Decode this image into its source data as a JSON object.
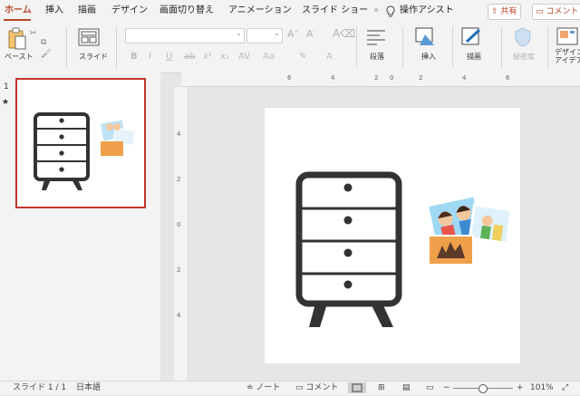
{
  "tabs": [
    "ホーム",
    "挿入",
    "描画",
    "デザイン",
    "画面切り替え",
    "アニメーション",
    "スライド ショー",
    "操作アシスト"
  ],
  "more_tabs": "»",
  "share_label": "共有",
  "comment_label": "コメント",
  "ribbon": {
    "paste": "ペースト",
    "slide": "スライド",
    "paragraph": "段落",
    "insert": "挿入",
    "draw": "描画",
    "sensitivity": "秘密度",
    "designer_line1": "デザイン",
    "designer_line2": "アイデア"
  },
  "thumbnail": {
    "number": "1",
    "star": "★"
  },
  "ruler_numbers_h": [
    "6",
    "4",
    "2",
    "0",
    "2",
    "4",
    "6"
  ],
  "ruler_numbers_v": [
    "4",
    "2",
    "0",
    "2",
    "4"
  ],
  "status": {
    "slide_count": "スライド 1 / 1",
    "language": "日本語",
    "notes": "ノート",
    "comments": "コメント",
    "zoom": "101%",
    "zoom_fraction": 0.48
  },
  "colors": {
    "accent": "#b7472a",
    "selection": "#c5332b"
  }
}
